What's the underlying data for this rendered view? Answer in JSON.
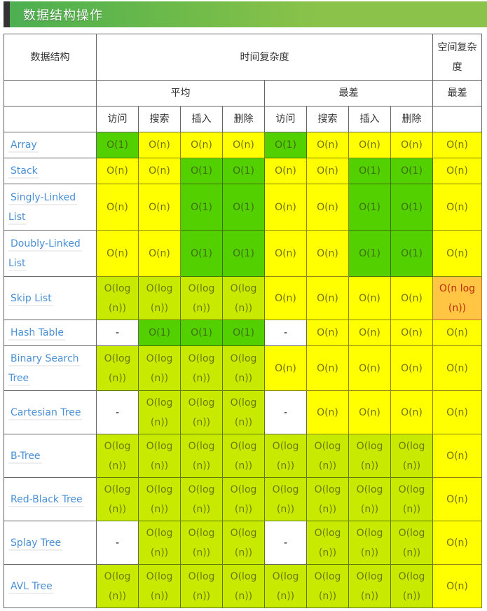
{
  "title": "数据结构操作",
  "header": {
    "col_structure": "数据结构",
    "time_complexity": "时间复杂度",
    "space_complexity": "空间复杂度",
    "average": "平均",
    "worst": "最差",
    "space_worst": "最差",
    "ops": [
      "访问",
      "搜索",
      "插入",
      "删除",
      "访问",
      "搜索",
      "插入",
      "删除"
    ]
  },
  "colors": {
    "green": "#53d000",
    "yellow": "#ffff00",
    "yellow_green": "#c8ea00",
    "orange": "#ffc543",
    "link": "#4a8fd6",
    "title_bar": "#8bc34a"
  },
  "rows": [
    {
      "name": [
        "Array"
      ],
      "cells": [
        {
          "v": "O(1)",
          "c": "g"
        },
        {
          "v": "O(n)",
          "c": "y"
        },
        {
          "v": "O(n)",
          "c": "y"
        },
        {
          "v": "O(n)",
          "c": "y"
        },
        {
          "v": "O(1)",
          "c": "g"
        },
        {
          "v": "O(n)",
          "c": "y"
        },
        {
          "v": "O(n)",
          "c": "y"
        },
        {
          "v": "O(n)",
          "c": "y"
        },
        {
          "v": "O(n)",
          "c": "y"
        }
      ]
    },
    {
      "name": [
        "Stack"
      ],
      "cells": [
        {
          "v": "O(n)",
          "c": "y"
        },
        {
          "v": "O(n)",
          "c": "y"
        },
        {
          "v": "O(1)",
          "c": "g"
        },
        {
          "v": "O(1)",
          "c": "g"
        },
        {
          "v": "O(n)",
          "c": "y"
        },
        {
          "v": "O(n)",
          "c": "y"
        },
        {
          "v": "O(1)",
          "c": "g"
        },
        {
          "v": "O(1)",
          "c": "g"
        },
        {
          "v": "O(n)",
          "c": "y"
        }
      ]
    },
    {
      "name": [
        "Singly-Linked",
        "List"
      ],
      "cells": [
        {
          "v": "O(n)",
          "c": "y"
        },
        {
          "v": "O(n)",
          "c": "y"
        },
        {
          "v": "O(1)",
          "c": "g"
        },
        {
          "v": "O(1)",
          "c": "g"
        },
        {
          "v": "O(n)",
          "c": "y"
        },
        {
          "v": "O(n)",
          "c": "y"
        },
        {
          "v": "O(1)",
          "c": "g"
        },
        {
          "v": "O(1)",
          "c": "g"
        },
        {
          "v": "O(n)",
          "c": "y"
        }
      ]
    },
    {
      "name": [
        "Doubly-Linked",
        "List"
      ],
      "cells": [
        {
          "v": "O(n)",
          "c": "y"
        },
        {
          "v": "O(n)",
          "c": "y"
        },
        {
          "v": "O(1)",
          "c": "g"
        },
        {
          "v": "O(1)",
          "c": "g"
        },
        {
          "v": "O(n)",
          "c": "y"
        },
        {
          "v": "O(n)",
          "c": "y"
        },
        {
          "v": "O(1)",
          "c": "g"
        },
        {
          "v": "O(1)",
          "c": "g"
        },
        {
          "v": "O(n)",
          "c": "y"
        }
      ]
    },
    {
      "name": [
        "Skip List"
      ],
      "cells": [
        {
          "v": "O(log (n))",
          "c": "lg"
        },
        {
          "v": "O(log (n))",
          "c": "lg"
        },
        {
          "v": "O(log (n))",
          "c": "lg"
        },
        {
          "v": "O(log (n))",
          "c": "lg"
        },
        {
          "v": "O(n)",
          "c": "y"
        },
        {
          "v": "O(n)",
          "c": "y"
        },
        {
          "v": "O(n)",
          "c": "y"
        },
        {
          "v": "O(n)",
          "c": "y"
        },
        {
          "v": "O(n log (n))",
          "c": "o"
        }
      ]
    },
    {
      "name": [
        "Hash Table"
      ],
      "cells": [
        {
          "v": "-",
          "c": "w"
        },
        {
          "v": "O(1)",
          "c": "g"
        },
        {
          "v": "O(1)",
          "c": "g"
        },
        {
          "v": "O(1)",
          "c": "g"
        },
        {
          "v": "-",
          "c": "w"
        },
        {
          "v": "O(n)",
          "c": "y"
        },
        {
          "v": "O(n)",
          "c": "y"
        },
        {
          "v": "O(n)",
          "c": "y"
        },
        {
          "v": "O(n)",
          "c": "y"
        }
      ]
    },
    {
      "name": [
        "Binary Search",
        "Tree"
      ],
      "cells": [
        {
          "v": "O(log (n))",
          "c": "lg"
        },
        {
          "v": "O(log (n))",
          "c": "lg"
        },
        {
          "v": "O(log (n))",
          "c": "lg"
        },
        {
          "v": "O(log (n))",
          "c": "lg"
        },
        {
          "v": "O(n)",
          "c": "y"
        },
        {
          "v": "O(n)",
          "c": "y"
        },
        {
          "v": "O(n)",
          "c": "y"
        },
        {
          "v": "O(n)",
          "c": "y"
        },
        {
          "v": "O(n)",
          "c": "y"
        }
      ]
    },
    {
      "name": [
        "Cartesian Tree"
      ],
      "cells": [
        {
          "v": "-",
          "c": "w"
        },
        {
          "v": "O(log (n))",
          "c": "lg"
        },
        {
          "v": "O(log (n))",
          "c": "lg"
        },
        {
          "v": "O(log (n))",
          "c": "lg"
        },
        {
          "v": "-",
          "c": "w"
        },
        {
          "v": "O(n)",
          "c": "y"
        },
        {
          "v": "O(n)",
          "c": "y"
        },
        {
          "v": "O(n)",
          "c": "y"
        },
        {
          "v": "O(n)",
          "c": "y"
        }
      ]
    },
    {
      "name": [
        "B-Tree"
      ],
      "cells": [
        {
          "v": "O(log (n))",
          "c": "lg"
        },
        {
          "v": "O(log (n))",
          "c": "lg"
        },
        {
          "v": "O(log (n))",
          "c": "lg"
        },
        {
          "v": "O(log (n))",
          "c": "lg"
        },
        {
          "v": "O(log (n))",
          "c": "lg"
        },
        {
          "v": "O(log (n))",
          "c": "lg"
        },
        {
          "v": "O(log (n))",
          "c": "lg"
        },
        {
          "v": "O(log (n))",
          "c": "lg"
        },
        {
          "v": "O(n)",
          "c": "y"
        }
      ]
    },
    {
      "name": [
        "Red-Black Tree"
      ],
      "cells": [
        {
          "v": "O(log (n))",
          "c": "lg"
        },
        {
          "v": "O(log (n))",
          "c": "lg"
        },
        {
          "v": "O(log (n))",
          "c": "lg"
        },
        {
          "v": "O(log (n))",
          "c": "lg"
        },
        {
          "v": "O(log (n))",
          "c": "lg"
        },
        {
          "v": "O(log (n))",
          "c": "lg"
        },
        {
          "v": "O(log (n))",
          "c": "lg"
        },
        {
          "v": "O(log (n))",
          "c": "lg"
        },
        {
          "v": "O(n)",
          "c": "y"
        }
      ]
    },
    {
      "name": [
        "Splay Tree"
      ],
      "cells": [
        {
          "v": "-",
          "c": "w"
        },
        {
          "v": "O(log (n))",
          "c": "lg"
        },
        {
          "v": "O(log (n))",
          "c": "lg"
        },
        {
          "v": "O(log (n))",
          "c": "lg"
        },
        {
          "v": "-",
          "c": "w"
        },
        {
          "v": "O(log (n))",
          "c": "lg"
        },
        {
          "v": "O(log (n))",
          "c": "lg"
        },
        {
          "v": "O(log (n))",
          "c": "lg"
        },
        {
          "v": "O(n)",
          "c": "y"
        }
      ]
    },
    {
      "name": [
        "AVL Tree"
      ],
      "cells": [
        {
          "v": "O(log (n))",
          "c": "lg"
        },
        {
          "v": "O(log (n))",
          "c": "lg"
        },
        {
          "v": "O(log (n))",
          "c": "lg"
        },
        {
          "v": "O(log (n))",
          "c": "lg"
        },
        {
          "v": "O(log (n))",
          "c": "lg"
        },
        {
          "v": "O(log (n))",
          "c": "lg"
        },
        {
          "v": "O(log (n))",
          "c": "lg"
        },
        {
          "v": "O(log (n))",
          "c": "lg"
        },
        {
          "v": "O(n)",
          "c": "y"
        }
      ]
    }
  ]
}
